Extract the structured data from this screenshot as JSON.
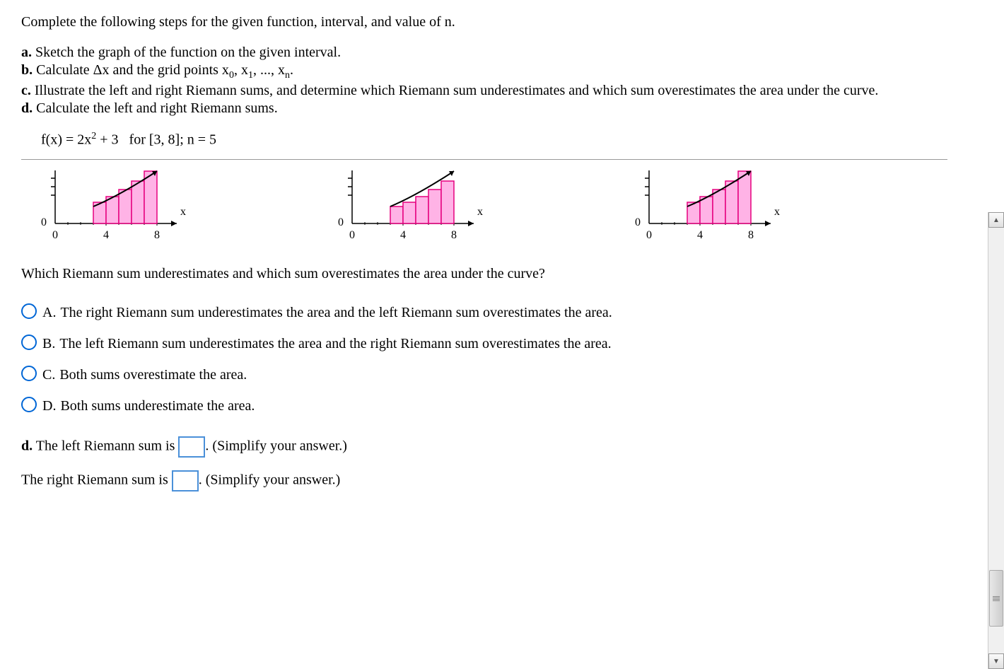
{
  "intro": "Complete the following steps for the given function, interval, and value of n.",
  "steps": {
    "a": {
      "label": "a.",
      "text": " Sketch the graph of the function on the given interval."
    },
    "b": {
      "label": "b.",
      "text_pre": " Calculate Δx and the grid points x",
      "sub0": "0",
      "mid1": ", x",
      "sub1": "1",
      "mid2": ", ..., x",
      "subn": "n",
      "text_post": "."
    },
    "c": {
      "label": "c.",
      "text": " Illustrate the left and right Riemann sums, and determine which Riemann sum underestimates and which sum overestimates the area under the curve."
    },
    "d": {
      "label": "d.",
      "text": " Calculate the left and right Riemann sums."
    }
  },
  "formula": {
    "fx": "f(x) = 2x",
    "exp": "2",
    "plus": " + 3",
    "for": "   for [3, 8]; n = 5"
  },
  "graph_labels": {
    "x": "x",
    "zero": "0",
    "four": "4",
    "eight": "8"
  },
  "question": "Which Riemann sum underestimates and which sum overestimates the area under the curve?",
  "options": {
    "A": {
      "letter": "A.",
      "text": "The right Riemann sum underestimates the area and the left Riemann sum overestimates the area."
    },
    "B": {
      "letter": "B.",
      "text": "The left Riemann sum underestimates the area and the right Riemann sum overestimates the area."
    },
    "C": {
      "letter": "C.",
      "text": "Both sums overestimate the area."
    },
    "D": {
      "letter": "D.",
      "text": "Both sums underestimate the area."
    }
  },
  "partd": {
    "label": "d.",
    "left_text_pre": " The left Riemann sum is ",
    "left_text_post": ". (Simplify your answer.)",
    "right_text_pre": "The right Riemann sum is ",
    "right_text_post": ". (Simplify your answer.)"
  },
  "chart_data": {
    "type": "riemann-illustration",
    "function": "f(x) = 2x^2 + 3",
    "interval": [
      3,
      8
    ],
    "n": 5,
    "delta_x": 1,
    "grid_points": [
      3,
      4,
      5,
      6,
      7,
      8
    ],
    "axis_ticks": {
      "x": [
        0,
        4,
        8
      ],
      "y": [
        0
      ]
    },
    "charts": [
      {
        "description": "right Riemann sum bars with curve",
        "bars_x_start": [
          3,
          4,
          5,
          6,
          7
        ],
        "bars_height_sample": "right"
      },
      {
        "description": "left Riemann sum bars with curve",
        "bars_x_start": [
          3,
          4,
          5,
          6,
          7
        ],
        "bars_height_sample": "left"
      },
      {
        "description": "right Riemann sum bars with curve (duplicate)",
        "bars_x_start": [
          3,
          4,
          5,
          6,
          7
        ],
        "bars_height_sample": "right"
      }
    ]
  }
}
